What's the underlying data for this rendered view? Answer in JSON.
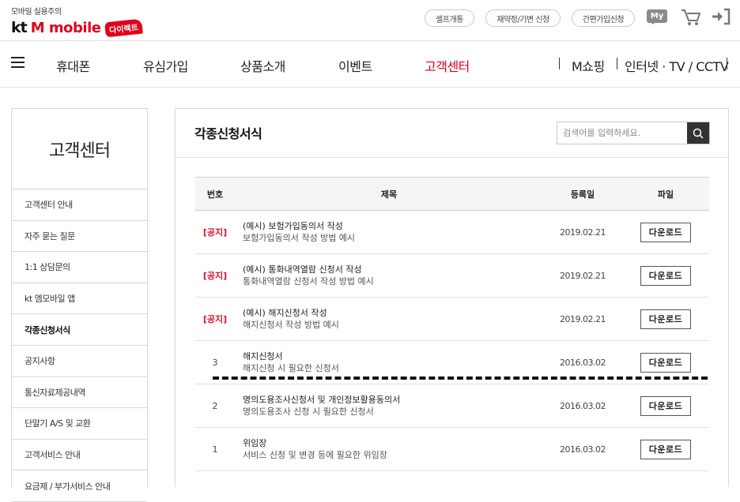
{
  "header": {
    "tagline": "모바일 실용주의",
    "brand_kt": "kt",
    "brand_mobile": "M mobile",
    "brand_direct": "다이렉트",
    "util_links": [
      "셀프개통",
      "재약정/기변 신청",
      "간편가입신청"
    ],
    "my_label": "My"
  },
  "gnb": {
    "items": [
      "휴대폰",
      "유심가입",
      "상품소개",
      "이벤트",
      "고객센터"
    ],
    "active": "고객센터",
    "right_items": [
      "M쇼핑",
      "인터넷 · TV / CCTV"
    ]
  },
  "sidebar": {
    "title": "고객센터",
    "items": [
      {
        "label": "고객센터 안내"
      },
      {
        "label": "자주 묻는 질문"
      },
      {
        "label": "1:1 상담문의"
      },
      {
        "label": "kt 엠모바일 앱"
      },
      {
        "label": "각종신청서식"
      },
      {
        "label": "공지사항"
      },
      {
        "label": "통신자료제공내역"
      },
      {
        "label": "단말기 A/S 및 교환"
      },
      {
        "label": "고객서비스 안내"
      },
      {
        "label": "요금제 / 부가서비스 안내"
      }
    ],
    "active_index": 4
  },
  "main": {
    "page_title": "각종신청서식",
    "search_placeholder": "검색어를 입력하세요.",
    "columns": [
      "번호",
      "제목",
      "등록일",
      "파일"
    ],
    "rows": [
      {
        "num": "[공지]",
        "title": "(예시) 보험가입동의서 작성",
        "desc": "보험가입동의서 작성 방법 예시",
        "date": "2019.02.21",
        "file": "다운로드"
      },
      {
        "num": "[공지]",
        "title": "(예시) 통화내역열람 신청서 작성",
        "desc": "통화내역열람 신청서 작성 방법 예시",
        "date": "2019.02.21",
        "file": "다운로드"
      },
      {
        "num": "[공지]",
        "title": "(예시) 해지신청서 작성",
        "desc": "해지신청서 작성 방법 예시",
        "date": "2019.02.21",
        "file": "다운로드"
      },
      {
        "num": "3",
        "title": "해지신청서",
        "desc": "해지신청 시 필요한 신청서",
        "date": "2016.03.02",
        "file": "다운로드"
      },
      {
        "num": "2",
        "title": "명의도용조사신청서 및 개인정보활용동의서",
        "desc": "명의도용조사 신청 시 필요한 신청서",
        "date": "2016.03.02",
        "file": "다운로드"
      },
      {
        "num": "1",
        "title": "위임장",
        "desc": "서비스 신청 및 변경 등에 필요한 위임장",
        "date": "2016.03.02",
        "file": "다운로드"
      }
    ]
  },
  "colors": {
    "accent": "#e2001a",
    "notice": "#d3162f",
    "dark_button": "#333333"
  }
}
